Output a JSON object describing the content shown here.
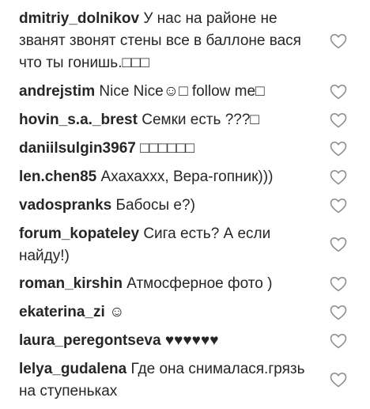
{
  "comments": [
    {
      "username": "dmitriy_dolnikov",
      "text": "У нас на районе не званят звонят стены все в баллоне вася что ты гонишь.□□□"
    },
    {
      "username": "andrejstim",
      "text": "Nice Nice☺□ follow me□"
    },
    {
      "username": "hovin_s.a._brest",
      "text": "Семки есть ???□"
    },
    {
      "username": "daniilsulgin3967",
      "text": "□□□□□□"
    },
    {
      "username": "len.chen85",
      "text": "Ахахаххх, Вера-гопник)))"
    },
    {
      "username": "vadospranks",
      "text": "Бабосы е?)"
    },
    {
      "username": "forum_kopateley",
      "text": "Сига есть? А если найду!)"
    },
    {
      "username": "roman_kirshin",
      "text": "Атмосферное фото )"
    },
    {
      "username": "ekaterina_zi",
      "text": "☺"
    },
    {
      "username": "laura_peregontseva",
      "text": "♥♥♥♥♥♥"
    },
    {
      "username": "lelya_gudalena",
      "text": "Где она снималася.грязь на ступеньках"
    }
  ],
  "icons": {
    "like": "heart-outline-icon"
  },
  "colors": {
    "text": "#262626",
    "icon": "#8e8e8e"
  }
}
